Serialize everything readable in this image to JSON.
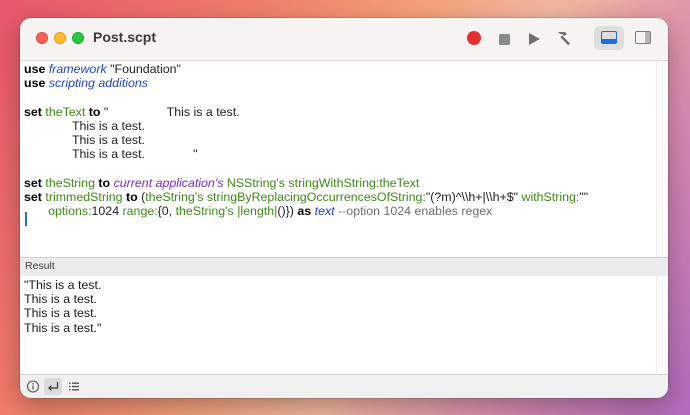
{
  "window": {
    "title": "Post.scpt"
  },
  "toolbar": {
    "record_icon": "record-icon",
    "stop_icon": "stop-icon",
    "run_icon": "play-icon",
    "compile_icon": "hammer-icon",
    "view_bottom_icon": "bottom-panel-icon",
    "view_side_icon": "side-panel-icon"
  },
  "code": {
    "l1": {
      "kw": "use",
      "app": "framework",
      "str": " \"Foundation\""
    },
    "l2": {
      "kw": "use",
      "app": "scripting additions"
    },
    "l4": {
      "kw1": "set",
      "var": "theText",
      "kw2": "to",
      "str": " \"                 This is a test."
    },
    "l5": "              This is a test.",
    "l6": "              This is a test.",
    "l7": "              This is a test.              \"",
    "l9": {
      "kw1": "set",
      "var1": "theString",
      "kw2": "to",
      "cls": "current application's",
      "var2": "NSString's stringWithString:theText"
    },
    "l10": {
      "kw1": "set",
      "var1": "trimmedString",
      "kw2": "to",
      "p1": " (",
      "var2": "theString's stringByReplacingOccurrencesOfString:",
      "str1": "\"(?m)^\\\\h+|\\\\h+$\"",
      "var3": " withString:",
      "str2": "\"\""
    },
    "l11": {
      "var1": "options:",
      "n1": "1024",
      "var2": " range:",
      "p1": "{0, ",
      "var3": "theString's |length|",
      "p2": "()})",
      "kw": "as",
      "app": "text",
      "cm": " --option 1024 enables regex"
    }
  },
  "result": {
    "label": "Result",
    "lines": [
      "\"This is a test.",
      "This is a test.",
      "This is a test.",
      "This is a test.\""
    ]
  },
  "bottombar": {
    "info_icon": "info-icon",
    "return_icon": "return-arrow-icon",
    "list_icon": "list-icon"
  }
}
